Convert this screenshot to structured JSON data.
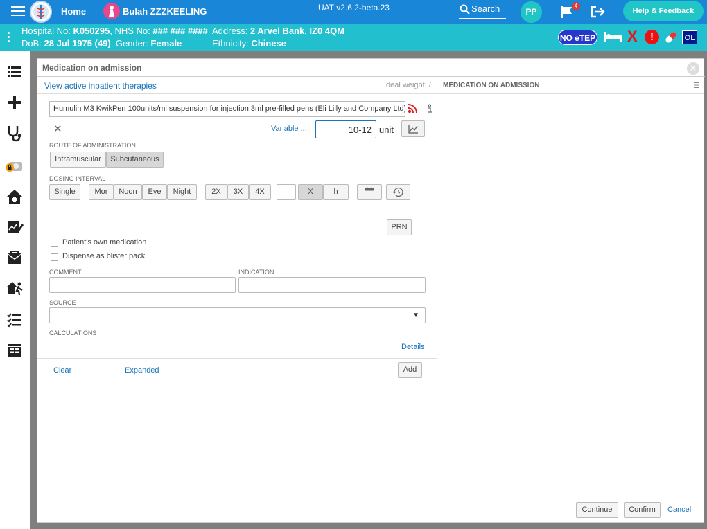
{
  "header": {
    "home": "Home",
    "patient_name": "Bulah ZZZKEELING",
    "version": "UAT v2.6.2-beta.23",
    "search": "Search",
    "user_initials": "PP",
    "notification_count": "4",
    "help": "Help & Feedback"
  },
  "banner": {
    "hospital_label": "Hospital No:",
    "hospital_no": "K050295",
    "nhs_label": ", NHS No:",
    "nhs_no": "### ### ####",
    "dob_label": "DoB:",
    "dob": "28 Jul 1975 (49)",
    "gender_label": ", Gender:",
    "gender": "Female",
    "address_label": "Address:",
    "address": "2 Arvel Bank, IZ0 4QM",
    "ethnicity_label": "Ethnicity:",
    "ethnicity": "Chinese",
    "no_etep": "NO eTEP",
    "alert_glyph": "!",
    "x_glyph": "X",
    "ol": "OL"
  },
  "dialog": {
    "title": "Medication on admission",
    "view_active": "View active inpatient therapies",
    "ideal_weight": "Ideal weight: /",
    "right_title": "MEDICATION ON ADMISSION",
    "drug": "Humulin M3 KwikPen 100units/ml suspension for injection 3ml pre-filled pens (Eli Lilly and Company Ltd)",
    "variable": "Variable ...",
    "dose": "10-12",
    "unit": "unit",
    "route_label": "ROUTE OF ADMINISTRATION",
    "routes": [
      "Intramuscular",
      "Subcutaneous"
    ],
    "dosing_label": "DOSING INTERVAL",
    "single": "Single",
    "times": [
      "Mor",
      "Noon",
      "Eve",
      "Night"
    ],
    "freq": [
      "2X",
      "3X",
      "4X"
    ],
    "interval_unit_x": "X",
    "interval_unit_h": "h",
    "prn": "PRN",
    "own_med": "Patient's own medication",
    "blister": "Dispense as blister pack",
    "comment_label": "COMMENT",
    "indication_label": "INDICATION",
    "source_label": "SOURCE",
    "calculations_label": "CALCULATIONS",
    "details": "Details",
    "clear": "Clear",
    "expanded": "Expanded",
    "add": "Add",
    "continue": "Continue",
    "confirm": "Confirm",
    "cancel": "Cancel"
  }
}
